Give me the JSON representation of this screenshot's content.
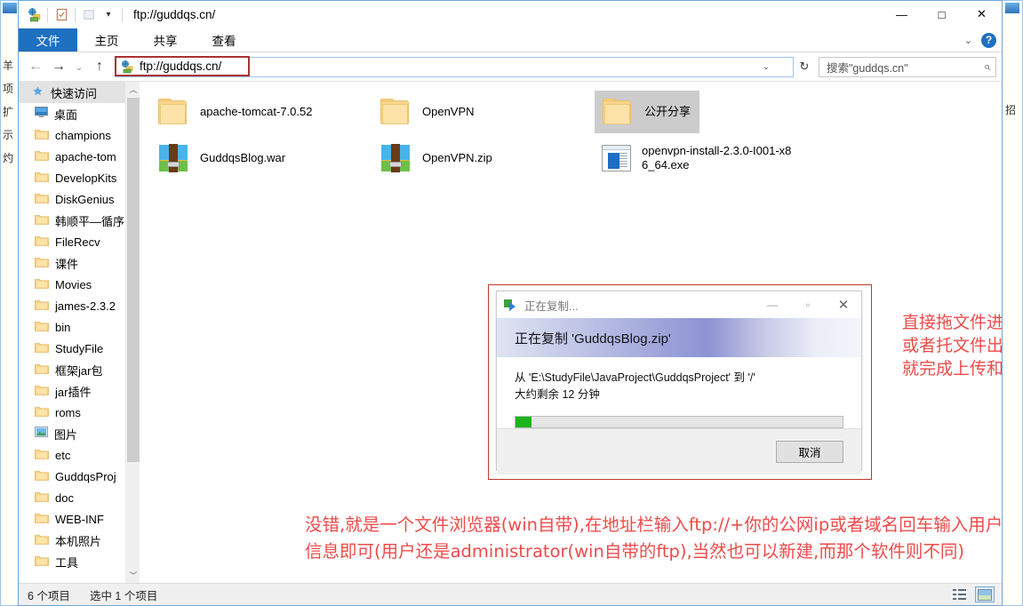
{
  "window": {
    "title": "ftp://guddqs.cn/",
    "controls": {
      "minimize": "—",
      "maximize": "□",
      "close": "✕"
    }
  },
  "quick_access_toolbar": {
    "properties_label": "属性",
    "new_folder_label": "新建文件夹",
    "customize_label": "自定义快速访问工具栏"
  },
  "ribbon": {
    "tabs": [
      {
        "label": "文件",
        "active": true
      },
      {
        "label": "主页",
        "active": false
      },
      {
        "label": "共享",
        "active": false
      },
      {
        "label": "查看",
        "active": false
      }
    ],
    "collapse_icon": "chevron-down",
    "help_label": "?"
  },
  "navigation": {
    "back": "←",
    "forward": "→",
    "recent": "⌄",
    "up": "↑",
    "address_value": "ftp://guddqs.cn/",
    "address_dropdown": "⌄",
    "refresh": "↻"
  },
  "search": {
    "placeholder": "搜索\"guddqs.cn\"",
    "icon": "search-icon"
  },
  "sidebar": {
    "items": [
      {
        "label": "快速访问",
        "type": "header",
        "icon": "star-icon",
        "pinned": false
      },
      {
        "label": "桌面",
        "type": "desktop",
        "pinned": true
      },
      {
        "label": "champions",
        "type": "folder",
        "pinned": true
      },
      {
        "label": "apache-tom",
        "type": "folder",
        "pinned": true
      },
      {
        "label": "DevelopKits",
        "type": "folder",
        "pinned": true
      },
      {
        "label": "DiskGenius",
        "type": "folder",
        "pinned": true
      },
      {
        "label": "韩顺平—循序",
        "type": "folder",
        "pinned": true
      },
      {
        "label": "FileRecv",
        "type": "folder",
        "pinned": true
      },
      {
        "label": "课件",
        "type": "folder",
        "pinned": true
      },
      {
        "label": "Movies",
        "type": "folder",
        "pinned": true
      },
      {
        "label": "james-2.3.2",
        "type": "folder",
        "pinned": true
      },
      {
        "label": "bin",
        "type": "folder",
        "pinned": true
      },
      {
        "label": "StudyFile",
        "type": "folder",
        "pinned": true
      },
      {
        "label": "框架jar包",
        "type": "folder",
        "pinned": true
      },
      {
        "label": "jar插件",
        "type": "folder",
        "pinned": true
      },
      {
        "label": "roms",
        "type": "folder",
        "pinned": true
      },
      {
        "label": "图片",
        "type": "pictures",
        "pinned": true
      },
      {
        "label": "etc",
        "type": "folder",
        "pinned": true
      },
      {
        "label": "GuddqsProj",
        "type": "folder",
        "pinned": true
      },
      {
        "label": "doc",
        "type": "folder",
        "pinned": false
      },
      {
        "label": "WEB-INF",
        "type": "folder",
        "pinned": false
      },
      {
        "label": "本机照片",
        "type": "folder",
        "pinned": false
      },
      {
        "label": "工具",
        "type": "folder",
        "pinned": false
      }
    ]
  },
  "files": [
    {
      "name": "apache-tomcat-7.0.52",
      "icon": "folder-icon",
      "selected": false
    },
    {
      "name": "OpenVPN",
      "icon": "folder-icon",
      "selected": false
    },
    {
      "name": "公开分享",
      "icon": "folder-icon",
      "selected": true
    },
    {
      "name": "GuddqsBlog.war",
      "icon": "zip-archive-icon",
      "selected": false
    },
    {
      "name": "OpenVPN.zip",
      "icon": "zip-archive-icon",
      "selected": false
    },
    {
      "name": "openvpn-install-2.3.0-I001-x86_64.exe",
      "icon": "executable-icon",
      "selected": false
    }
  ],
  "copy_dialog": {
    "title": "正在复制...",
    "banner": "正在复制 'GuddqsBlog.zip'",
    "source_line": "从 'E:\\StudyFile\\JavaProject\\GuddqsProject' 到 '/'",
    "time_line": "大约剩余 12 分钟",
    "progress_percent": 5,
    "cancel_label": "取消",
    "controls": {
      "minimize": "—",
      "maximize": "▫",
      "close": "✕"
    }
  },
  "annotations": {
    "side_note": "直接拖文件进来\n或者托文件出去\n就完成上传和下载",
    "bottom_note": "没错,就是一个文件浏览器(win自带),在地址栏输入ftp://+你的公网ip或者域名回车输入用户\n信息即可(用户还是administrator(win自带的ftp),当然也可以新建,而那个软件则不同)",
    "color": "#ef4b4b"
  },
  "statusbar": {
    "item_count": "6 个项目",
    "selection": "选中 1 个项目",
    "view_details_label": "详细信息",
    "view_large_icons_label": "大图标"
  },
  "background_window": {
    "left_text": "羊 项 扩 示 灼",
    "right_text": "招"
  }
}
